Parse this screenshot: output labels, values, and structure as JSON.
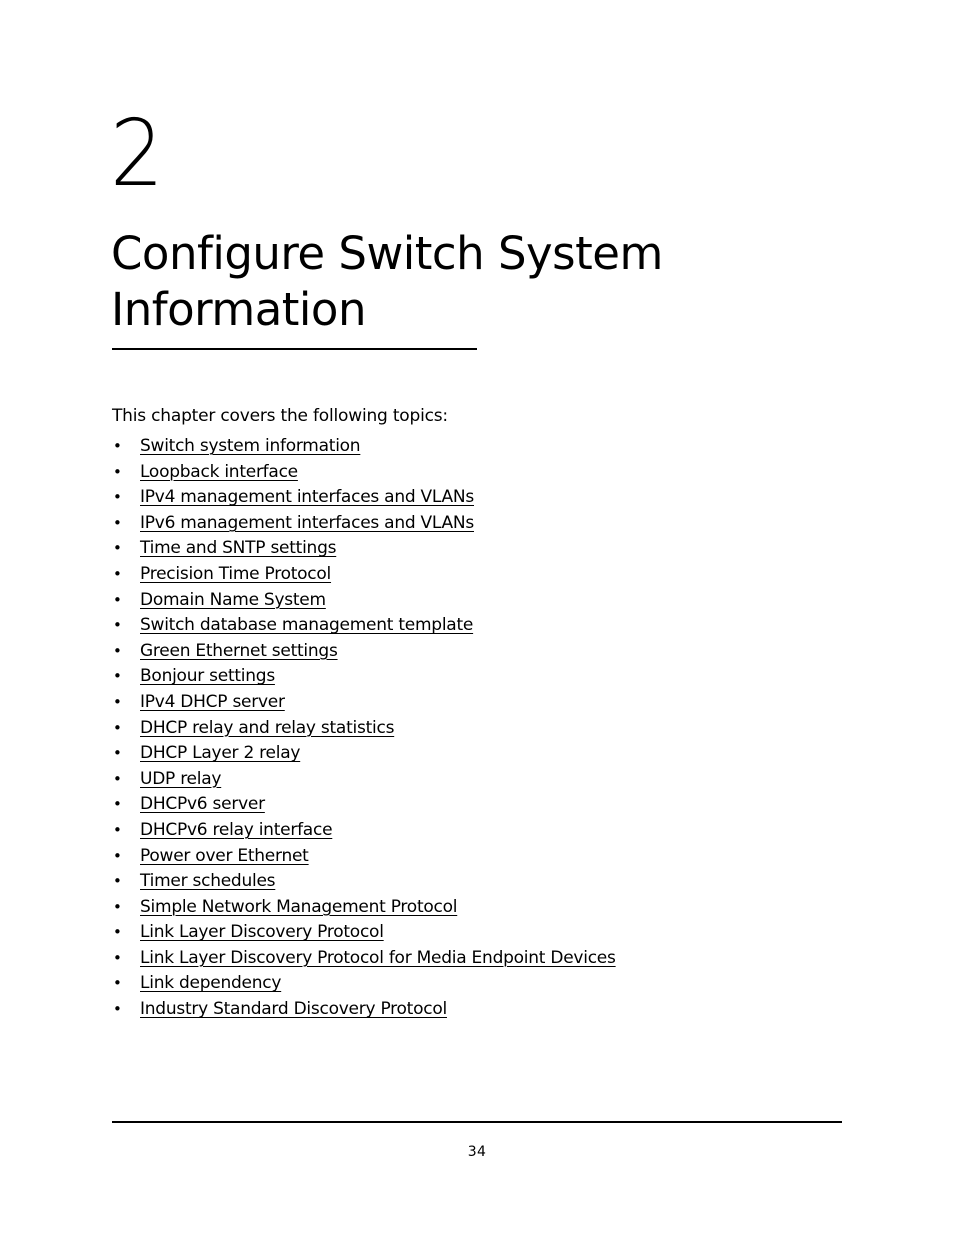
{
  "chapter": {
    "number": "2",
    "title": "Configure Switch System Information"
  },
  "intro": "This chapter covers the following topics:",
  "bullet_glyph": "•",
  "topics": [
    "Switch system information",
    "Loopback interface",
    "IPv4 management interfaces and VLANs",
    "IPv6 management interfaces and VLANs",
    "Time and SNTP settings",
    "Precision Time Protocol",
    "Domain Name System",
    "Switch database management template",
    "Green Ethernet settings",
    "Bonjour settings",
    "IPv4 DHCP server",
    "DHCP relay and relay statistics",
    "DHCP Layer 2 relay",
    "UDP relay",
    "DHCPv6 server",
    "DHCPv6 relay interface",
    "Power over Ethernet",
    "Timer schedules",
    "Simple Network Management Protocol",
    "Link Layer Discovery Protocol",
    "Link Layer Discovery Protocol for Media Endpoint Devices",
    "Link dependency",
    "Industry Standard Discovery Protocol"
  ],
  "footer": {
    "page_number": "34"
  }
}
